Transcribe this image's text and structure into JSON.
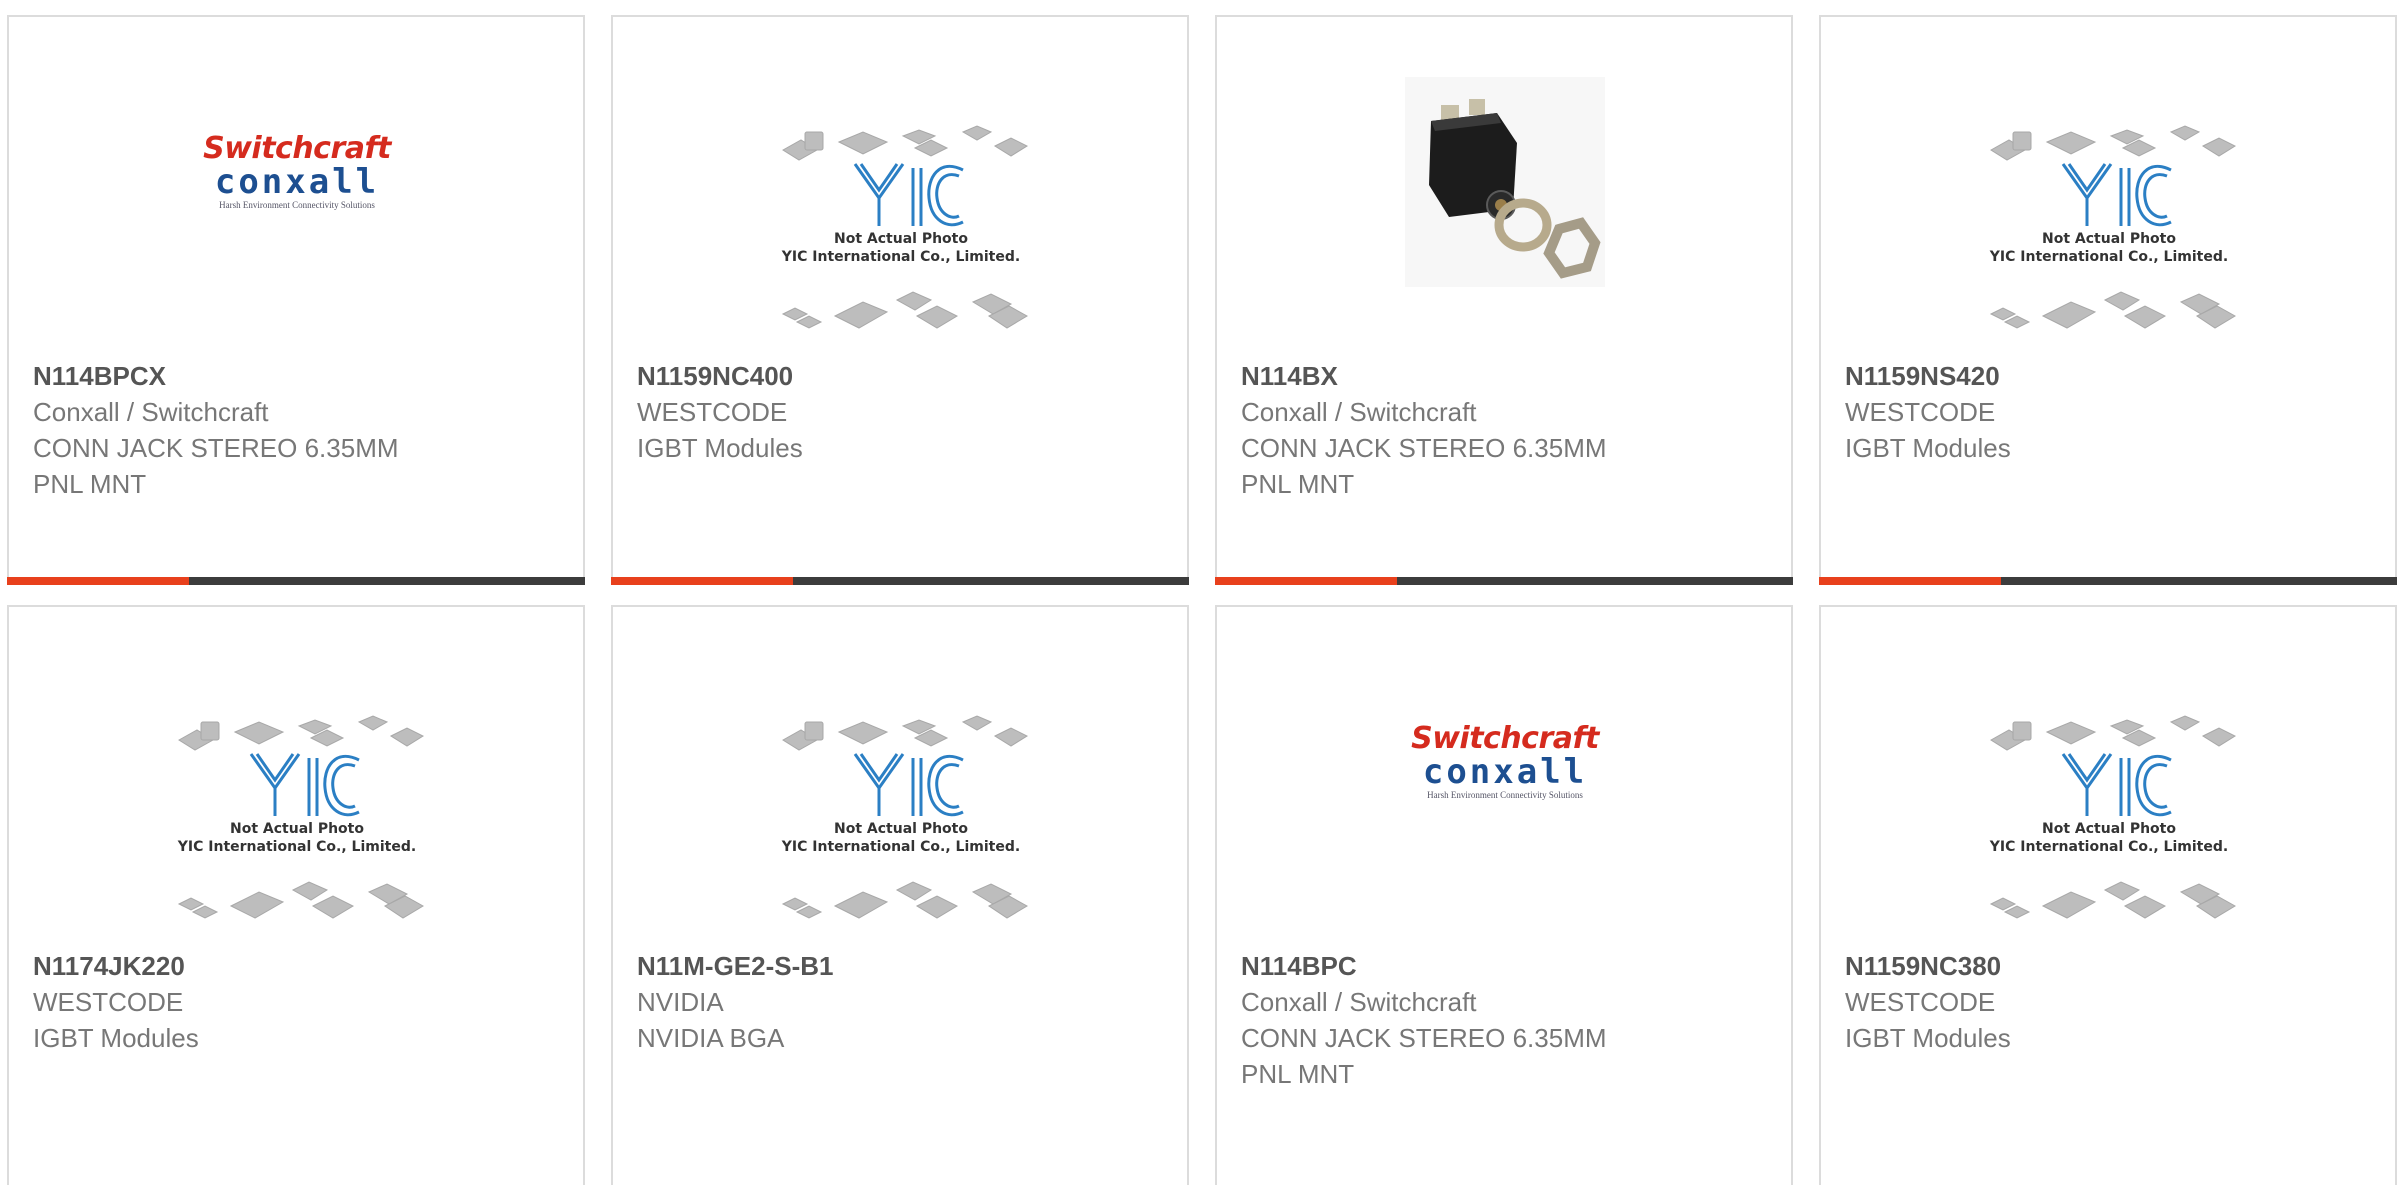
{
  "products": [
    {
      "part": "N114BPCX",
      "brand": "Conxall / Switchcraft",
      "desc1": "CONN JACK STEREO 6.35MM",
      "desc2": "PNL MNT",
      "image": "switchcraft-logo",
      "accent_bar": true
    },
    {
      "part": "N1159NC400",
      "brand": "WESTCODE",
      "desc1": "IGBT Modules",
      "desc2": "",
      "image": "yic-placeholder",
      "accent_bar": true
    },
    {
      "part": "N114BX",
      "brand": "Conxall / Switchcraft",
      "desc1": "CONN JACK STEREO 6.35MM",
      "desc2": "PNL MNT",
      "image": "jack-photo",
      "accent_bar": true
    },
    {
      "part": "N1159NS420",
      "brand": "WESTCODE",
      "desc1": "IGBT Modules",
      "desc2": "",
      "image": "yic-placeholder",
      "accent_bar": true
    },
    {
      "part": "N1174JK220",
      "brand": "WESTCODE",
      "desc1": "IGBT Modules",
      "desc2": "",
      "image": "yic-placeholder",
      "accent_bar": false
    },
    {
      "part": "N11M-GE2-S-B1",
      "brand": "NVIDIA",
      "desc1": "NVIDIA BGA",
      "desc2": "",
      "image": "yic-placeholder",
      "accent_bar": false
    },
    {
      "part": "N114BPC",
      "brand": "Conxall / Switchcraft",
      "desc1": "CONN JACK STEREO 6.35MM",
      "desc2": "PNL MNT",
      "image": "switchcraft-logo",
      "accent_bar": false
    },
    {
      "part": "N1159NC380",
      "brand": "WESTCODE",
      "desc1": "IGBT Modules",
      "desc2": "",
      "image": "yic-placeholder",
      "accent_bar": false
    }
  ],
  "logos": {
    "switchcraft_top": "Switchcraft",
    "switchcraft_mid": "conxall",
    "switchcraft_tag": "Harsh Environment Connectivity Solutions",
    "yic_caption1": "Not Actual Photo",
    "yic_caption2": "YIC International Co., Limited."
  },
  "colors": {
    "accent": "#e8401c",
    "bar_dark": "#3c3c3c",
    "border": "#dcdcdc",
    "part_text": "#555555",
    "body_text": "#777777",
    "switchcraft_red": "#d52b1e",
    "conxall_blue": "#1d4f91",
    "yic_blue": "#2b7fc4"
  }
}
